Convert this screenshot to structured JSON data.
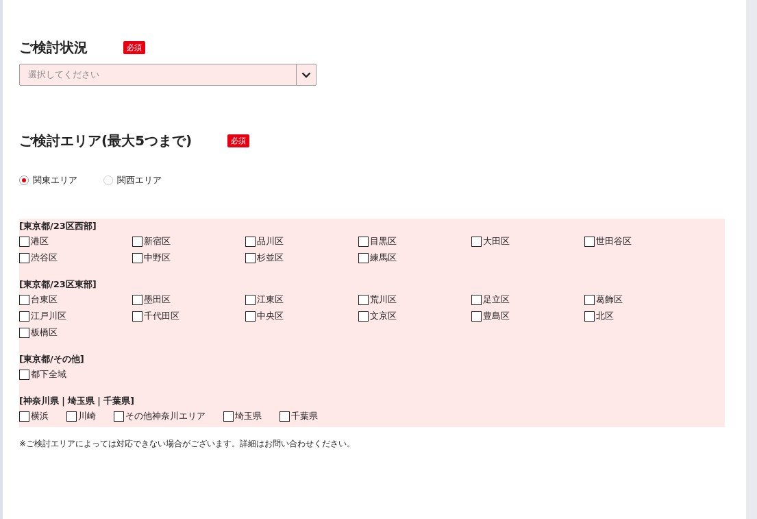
{
  "status_section": {
    "title": "ご検討状況",
    "badge": "必須",
    "select": {
      "placeholder": "選択してください"
    }
  },
  "area_section": {
    "title": "ご検討エリア(最大5つまで)",
    "badge": "必須",
    "regions": [
      {
        "label": "関東エリア",
        "selected": true
      },
      {
        "label": "関西エリア",
        "selected": false
      }
    ],
    "groups": [
      {
        "heading": "[東京都/23区西部]",
        "kind": "grid",
        "options": [
          {
            "label": "港区",
            "checked": false
          },
          {
            "label": "新宿区",
            "checked": false
          },
          {
            "label": "品川区",
            "checked": false
          },
          {
            "label": "目黒区",
            "checked": false
          },
          {
            "label": "大田区",
            "checked": false
          },
          {
            "label": "世田谷区",
            "checked": false
          },
          {
            "label": "渋谷区",
            "checked": false
          },
          {
            "label": "中野区",
            "checked": false
          },
          {
            "label": "杉並区",
            "checked": false
          },
          {
            "label": "練馬区",
            "checked": false
          }
        ]
      },
      {
        "heading": "[東京都/23区東部]",
        "kind": "grid",
        "options": [
          {
            "label": "台東区",
            "checked": false
          },
          {
            "label": "墨田区",
            "checked": false
          },
          {
            "label": "江東区",
            "checked": false
          },
          {
            "label": "荒川区",
            "checked": false
          },
          {
            "label": "足立区",
            "checked": false
          },
          {
            "label": "葛飾区",
            "checked": false
          },
          {
            "label": "江戸川区",
            "checked": false
          },
          {
            "label": "千代田区",
            "checked": false
          },
          {
            "label": "中央区",
            "checked": false
          },
          {
            "label": "文京区",
            "checked": false
          },
          {
            "label": "豊島区",
            "checked": false
          },
          {
            "label": "北区",
            "checked": false
          },
          {
            "label": "板橋区",
            "checked": false
          }
        ]
      },
      {
        "heading": "[東京都/その他]",
        "kind": "grid",
        "options": [
          {
            "label": "都下全域",
            "checked": false
          }
        ]
      },
      {
        "heading": "[神奈川県｜埼玉県｜千葉県]",
        "kind": "inline",
        "options": [
          {
            "label": "横浜",
            "checked": false
          },
          {
            "label": "川崎",
            "checked": false
          },
          {
            "label": "その他神奈川エリア",
            "checked": false
          },
          {
            "label": "埼玉県",
            "checked": false
          },
          {
            "label": "千葉県",
            "checked": false
          }
        ]
      }
    ],
    "note": "※ご検討エリアによっては対応できない場合がございます。詳細はお問い合わせください。"
  }
}
